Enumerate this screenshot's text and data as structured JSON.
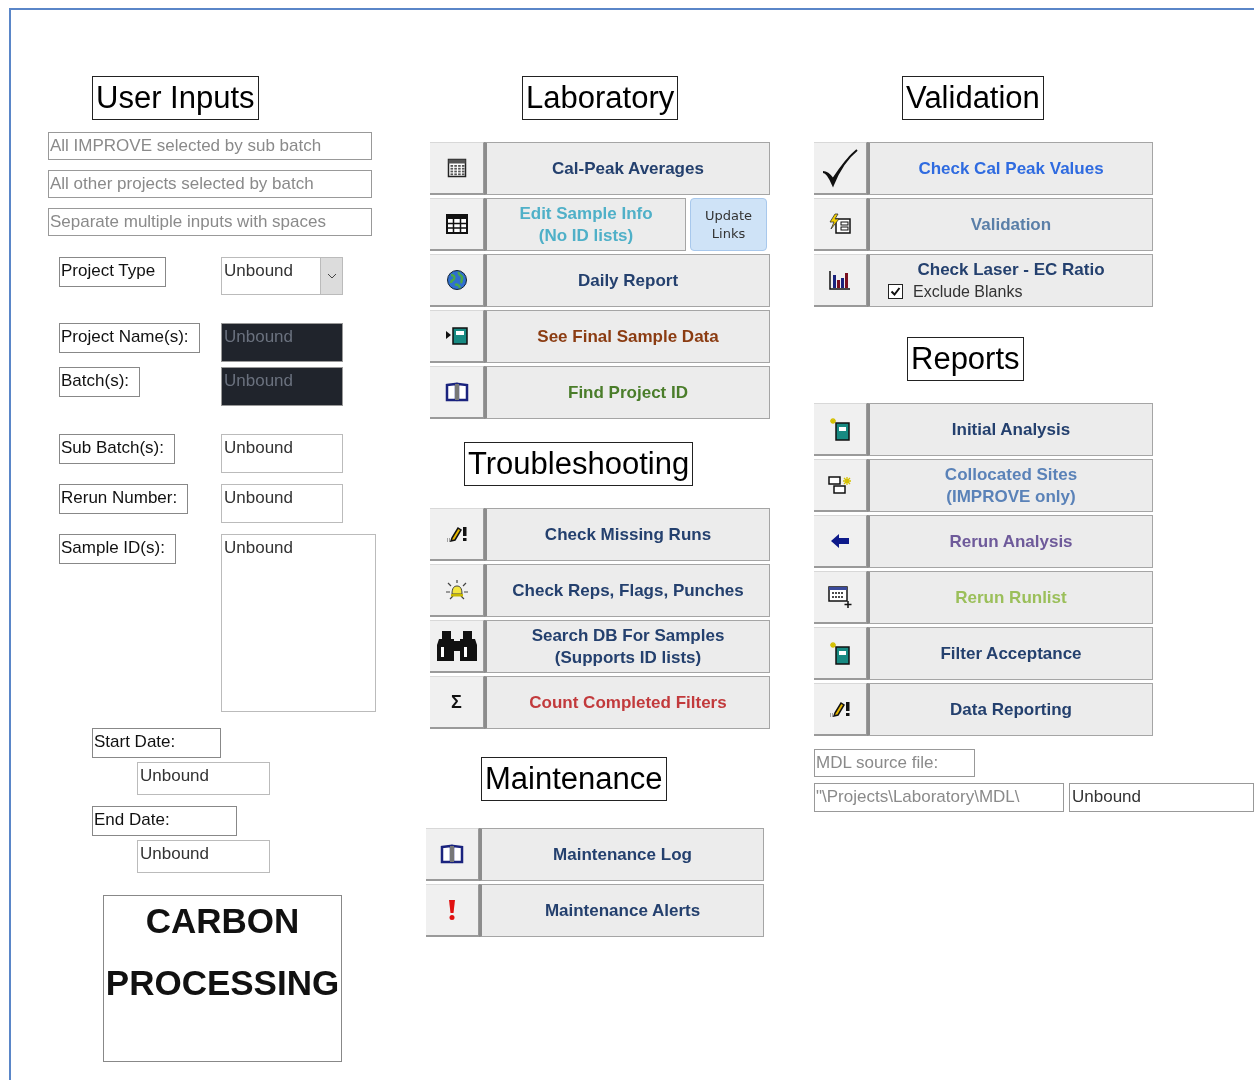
{
  "user_inputs": {
    "title": "User Inputs",
    "hints": [
      "All IMPROVE selected by sub batch",
      "All other projects selected by batch",
      "Separate multiple inputs with spaces"
    ],
    "fields": [
      {
        "kind": "combo",
        "label": "Project Type",
        "value": "Unbound"
      },
      {
        "kind": "dark",
        "label": "Project Name(s):",
        "value": "Unbound"
      },
      {
        "kind": "dark",
        "label": "Batch(s):",
        "value": "Unbound"
      },
      {
        "kind": "text",
        "label": "Sub Batch(s):",
        "value": "Unbound"
      },
      {
        "kind": "text",
        "label": "Rerun Number:",
        "value": "Unbound"
      },
      {
        "kind": "memo",
        "label": "Sample ID(s):",
        "value": "Unbound"
      }
    ],
    "dates": [
      {
        "label": "Start Date:",
        "value": "Unbound"
      },
      {
        "label": "End Date:",
        "value": "Unbound"
      }
    ],
    "logo": [
      "CARBON",
      "PROCESSING"
    ]
  },
  "laboratory": {
    "title": "Laboratory",
    "buttons": [
      {
        "kind": "calendar",
        "lines": [
          "Cal-Peak Averages"
        ],
        "color": "#24406e"
      },
      {
        "kind": "table",
        "lines": [
          "Edit Sample Info",
          "(No ID lists)"
        ],
        "color": "#4fb0c8",
        "side_button": [
          "Update",
          "Links"
        ]
      },
      {
        "kind": "globe",
        "lines": [
          "Daily Report"
        ],
        "color": "#24406e"
      },
      {
        "kind": "notebook-arrow",
        "lines": [
          "See Final Sample Data"
        ],
        "color": "#8b3c12"
      },
      {
        "kind": "book",
        "lines": [
          "Find Project ID"
        ],
        "color": "#4a7d2a"
      }
    ]
  },
  "troubleshooting": {
    "title": "Troubleshooting",
    "buttons": [
      {
        "kind": "pencil-alert",
        "lines": [
          "Check Missing Runs"
        ],
        "color": "#24406e"
      },
      {
        "kind": "bulb",
        "lines": [
          "Check Reps, Flags, Punches"
        ],
        "color": "#24406e"
      },
      {
        "kind": "binoculars",
        "lines": [
          "Search DB For Samples",
          "(Supports ID lists)"
        ],
        "color": "#24406e"
      },
      {
        "kind": "glyph",
        "glyph": "Σ",
        "lines": [
          "Count Completed Filters"
        ],
        "color": "#c23a3c"
      }
    ]
  },
  "maintenance": {
    "title": "Maintenance",
    "buttons": [
      {
        "kind": "book",
        "lines": [
          "Maintenance Log"
        ],
        "color": "#24406e"
      },
      {
        "kind": "alert",
        "lines": [
          "Maintenance Alerts"
        ],
        "color": "#24406e"
      }
    ]
  },
  "validation": {
    "title": "Validation",
    "buttons": [
      {
        "kind": "check",
        "lines": [
          "Check Cal Peak Values"
        ],
        "color": "#2f6be0"
      },
      {
        "kind": "lightning-form",
        "lines": [
          "Validation"
        ],
        "color": "#5a7fa8"
      },
      {
        "kind": "bar-chart",
        "lines": [
          "Check Laser - EC Ratio"
        ],
        "color": "#24406e",
        "checkbox": {
          "label": "Exclude Blanks",
          "checked": true
        }
      }
    ]
  },
  "reports": {
    "title": "Reports",
    "buttons": [
      {
        "kind": "notebook-star",
        "lines": [
          "Initial Analysis"
        ],
        "color": "#24406e"
      },
      {
        "kind": "windows-star",
        "lines": [
          "Collocated Sites",
          "(IMPROVE only)"
        ],
        "color": "#5a82b8"
      },
      {
        "kind": "arrow-left",
        "lines": [
          "Rerun Analysis"
        ],
        "color": "#6e5a9a"
      },
      {
        "kind": "list-plus",
        "lines": [
          "Rerun Runlist"
        ],
        "color": "#9bbf5a"
      },
      {
        "kind": "notebook-star",
        "lines": [
          "Filter Acceptance"
        ],
        "color": "#24406e"
      },
      {
        "kind": "pencil-alert",
        "lines": [
          "Data Reporting"
        ],
        "color": "#24406e"
      }
    ]
  },
  "mdl": {
    "label": "MDL source file:",
    "path": "\"\\Projects\\Laboratory\\MDL\\",
    "value": "Unbound"
  }
}
